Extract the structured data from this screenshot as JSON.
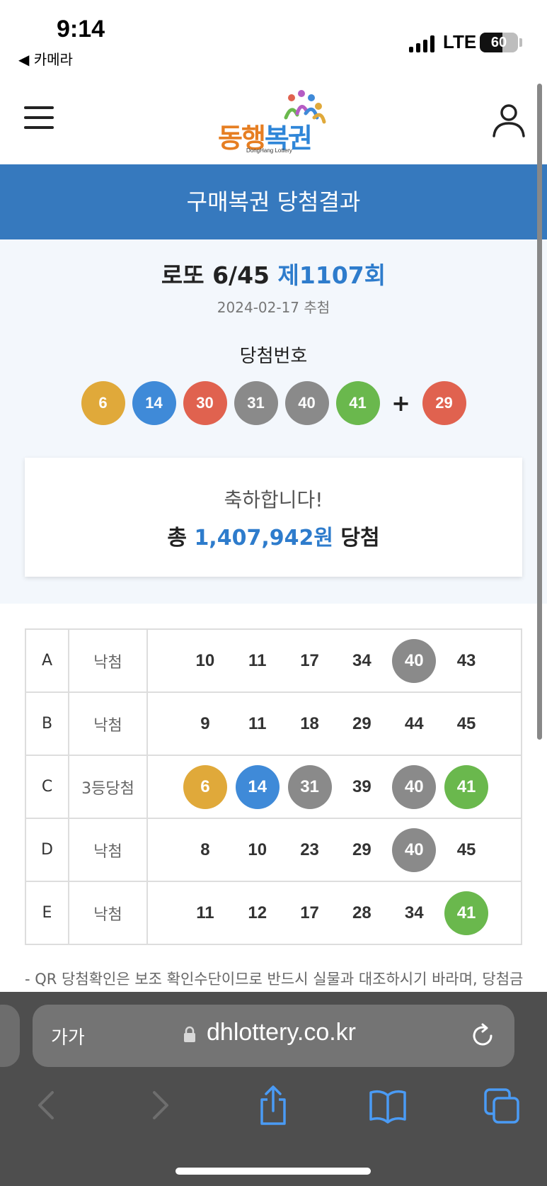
{
  "status_bar": {
    "time": "9:14",
    "back_app": "◀ 카메라",
    "network": "LTE",
    "battery": "60",
    "battery_level": 0.6
  },
  "header": {
    "logo_text_1": "동행",
    "logo_text_2": "복권",
    "logo_sub": "DongHang Lottery"
  },
  "page": {
    "title": "구매복권 당첨결과"
  },
  "draw": {
    "game": "로또 6/45",
    "round": "제1107회",
    "date": "2024-02-17 추첨",
    "winning_label": "당첨번호",
    "numbers": [
      {
        "value": "6",
        "color": "#e0a93a"
      },
      {
        "value": "14",
        "color": "#3f8ad8"
      },
      {
        "value": "30",
        "color": "#e0624f"
      },
      {
        "value": "31",
        "color": "#8a8a8a"
      },
      {
        "value": "40",
        "color": "#8a8a8a"
      },
      {
        "value": "41",
        "color": "#6ab84d"
      }
    ],
    "plus": "+",
    "bonus": {
      "value": "29",
      "color": "#e0624f"
    }
  },
  "result": {
    "congrats": "축하합니다!",
    "prefix": "총",
    "amount": "1,407,942원",
    "suffix": "당첨"
  },
  "tickets": [
    {
      "letter": "A",
      "status": "낙첨",
      "numbers": [
        {
          "value": "10"
        },
        {
          "value": "11"
        },
        {
          "value": "17"
        },
        {
          "value": "34"
        },
        {
          "value": "40",
          "hit": "#8a8a8a"
        },
        {
          "value": "43"
        }
      ]
    },
    {
      "letter": "B",
      "status": "낙첨",
      "numbers": [
        {
          "value": "9"
        },
        {
          "value": "11"
        },
        {
          "value": "18"
        },
        {
          "value": "29"
        },
        {
          "value": "44"
        },
        {
          "value": "45"
        }
      ]
    },
    {
      "letter": "C",
      "status": "3등당첨",
      "numbers": [
        {
          "value": "6",
          "hit": "#e0a93a"
        },
        {
          "value": "14",
          "hit": "#3f8ad8"
        },
        {
          "value": "31",
          "hit": "#8a8a8a"
        },
        {
          "value": "39"
        },
        {
          "value": "40",
          "hit": "#8a8a8a"
        },
        {
          "value": "41",
          "hit": "#6ab84d"
        }
      ]
    },
    {
      "letter": "D",
      "status": "낙첨",
      "numbers": [
        {
          "value": "8"
        },
        {
          "value": "10"
        },
        {
          "value": "23"
        },
        {
          "value": "29"
        },
        {
          "value": "40",
          "hit": "#8a8a8a"
        },
        {
          "value": "45"
        }
      ]
    },
    {
      "letter": "E",
      "status": "낙첨",
      "numbers": [
        {
          "value": "11"
        },
        {
          "value": "12"
        },
        {
          "value": "17"
        },
        {
          "value": "28"
        },
        {
          "value": "34"
        },
        {
          "value": "41",
          "hit": "#6ab84d"
        }
      ]
    }
  ],
  "notice": "- QR 당첨확인은 보조 확인수단이므로 반드시 실물과 대조하시기 바라며, 당첨금",
  "browser": {
    "aa": "가가",
    "url": "dhlottery.co.kr"
  },
  "colors": {
    "brand_blue": "#3679be",
    "accent_blue": "#2e7ccc",
    "logo_orange": "#e67e22"
  }
}
